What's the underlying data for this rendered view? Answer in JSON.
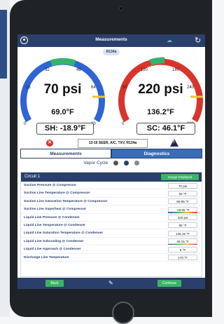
{
  "app": {
    "title": "Measurements",
    "refrigerant": "R134a"
  },
  "gauges": {
    "suction": {
      "pressure": "70 psi",
      "temperature": "69.0°F",
      "ticks": [
        "0",
        "16",
        "32",
        "48",
        "64",
        "80"
      ],
      "result": "SH: -18.9°F",
      "color": "#2f63d6"
    },
    "discharge": {
      "pressure": "220 psi",
      "temperature": "136.2°F",
      "ticks": [
        "0",
        "60",
        "120",
        "180",
        "240",
        "300"
      ],
      "result": "SC: 46.1°F",
      "color": "#d9342b"
    }
  },
  "system_info": "13-16 SEER, A/C, TXV, R134a",
  "tabs": [
    {
      "label": "Measurements"
    },
    {
      "label": "Diagnostics"
    }
  ],
  "section": {
    "title": "Vapor Cycle"
  },
  "circuit": {
    "name": "Circuit 1",
    "button_label": "Gauge Displayed",
    "rows": [
      {
        "label": "Suction Pressure @ Compressor",
        "value": "70 psi"
      },
      {
        "label": "Suction Line Temperature @ Compressor",
        "value": "50 °F"
      },
      {
        "label": "Suction Line Saturation Temperature @ Compressor",
        "value": "69.95 °F"
      },
      {
        "label": "Suction Line Superheat @ Compressor",
        "value": "-19.95 °F"
      },
      {
        "label": "Liquid Line Pressure @ Condenser",
        "value": "220 psi"
      },
      {
        "label": "Liquid Line Temperature @ Condenser",
        "value": "90 °F"
      },
      {
        "label": "Liquid Line Saturation Temperature @ Condenser",
        "value": "136.15 °F"
      },
      {
        "label": "Liquid Line Subcooling @ Condenser",
        "value": "46.15 °F"
      },
      {
        "label": "Liquid Line Approach @ Condenser",
        "value": "6 °F"
      },
      {
        "label": "Discharge Line Temperature",
        "value": "170 °F"
      }
    ]
  },
  "footer": {
    "back_label": "Back",
    "continue_label": "Continue"
  }
}
